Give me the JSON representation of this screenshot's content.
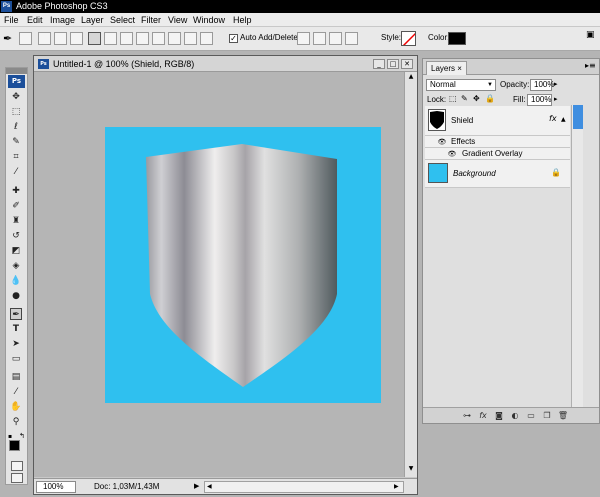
{
  "app": {
    "title": "Adobe Photoshop CS3",
    "icon_text": "Ps"
  },
  "menu": [
    "File",
    "Edit",
    "Image",
    "Layer",
    "Select",
    "Filter",
    "View",
    "Window",
    "Help"
  ],
  "options_bar": {
    "auto_add_delete": "Auto Add/Delete",
    "style_label": "Style:",
    "color_label": "Color:"
  },
  "document": {
    "title": "Untitled-1 @ 100% (Shield, RGB/8)",
    "zoom": "100%",
    "doc_size": "Doc: 1,03M/1,43M",
    "canvas_color": "#2fc0ef"
  },
  "layers_panel": {
    "tab": "Layers",
    "blend_mode": "Normal",
    "opacity_label": "Opacity:",
    "opacity": "100%",
    "lock_label": "Lock:",
    "fill_label": "Fill:",
    "fill": "100%",
    "layers": [
      {
        "name": "Shield",
        "fx": "fx"
      },
      {
        "name": "Effects"
      },
      {
        "name": "Gradient Overlay"
      },
      {
        "name": "Background"
      }
    ],
    "selected_color": "#3f8ee0"
  },
  "tools": [
    "move",
    "marquee",
    "lasso",
    "quick-select",
    "crop",
    "eyedropper",
    "healing",
    "brush",
    "clone-stamp",
    "history-brush",
    "eraser",
    "paint-bucket",
    "blur",
    "dodge",
    "pen",
    "type",
    "path-select",
    "shape",
    "notes",
    "hand",
    "zoom"
  ]
}
